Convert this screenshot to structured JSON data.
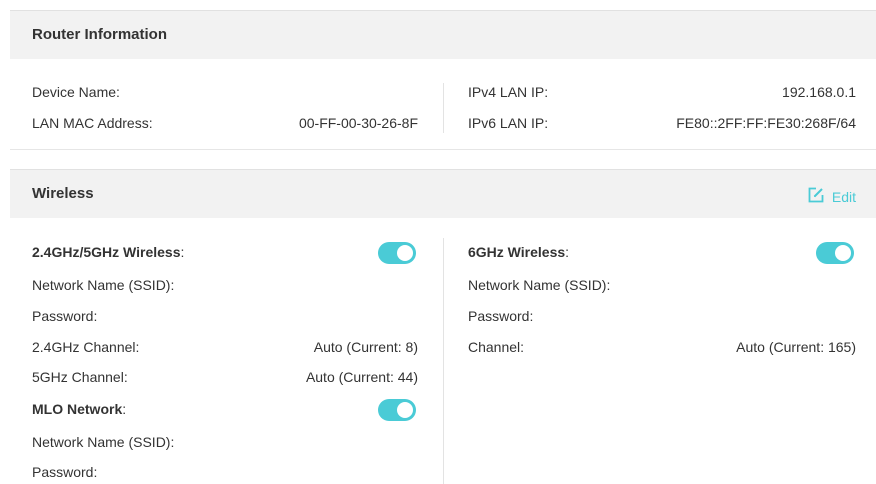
{
  "router_info": {
    "title": "Router Information",
    "device_name_label": "Device Name:",
    "device_name_value": "",
    "lan_mac_label": "LAN MAC Address:",
    "lan_mac_value": "00-FF-00-30-26-8F",
    "ipv4_label": "IPv4 LAN IP:",
    "ipv4_value": "192.168.0.1",
    "ipv6_label": "IPv6 LAN IP:",
    "ipv6_value": "FE80::2FF:FF:FE30:268F/64"
  },
  "wireless": {
    "title": "Wireless",
    "edit_label": "Edit",
    "accent_color": "#4acbd6",
    "left": {
      "band_label": "2.4GHz/5GHz Wireless",
      "band_enabled": true,
      "ssid_label": "Network Name (SSID):",
      "password_label": "Password:",
      "ch24_label": "2.4GHz Channel:",
      "ch24_value": "Auto (Current: 8)",
      "ch5_label": "5GHz Channel:",
      "ch5_value": "Auto (Current: 44)",
      "mlo_label": "MLO Network",
      "mlo_enabled": true,
      "mlo_ssid_label": "Network Name (SSID):",
      "mlo_password_label": "Password:"
    },
    "right": {
      "band_label": "6GHz Wireless",
      "band_enabled": true,
      "ssid_label": "Network Name (SSID):",
      "password_label": "Password:",
      "channel_label": "Channel:",
      "channel_value": "Auto (Current: 165)"
    }
  }
}
